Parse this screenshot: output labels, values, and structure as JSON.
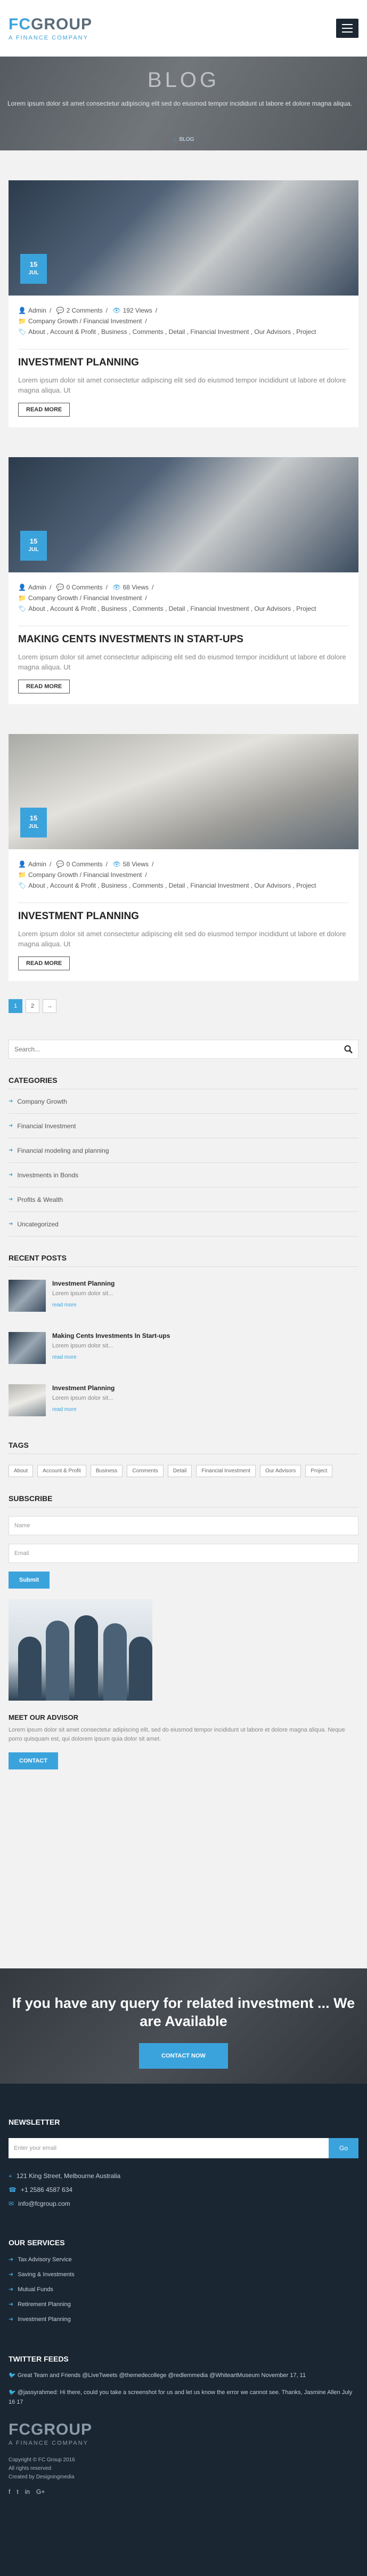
{
  "header": {
    "logo_text_a": "FC",
    "logo_text_b": "GROUP",
    "logo_tagline": "A FINANCE COMPANY"
  },
  "banner": {
    "title": "BLOG",
    "text": "Lorem ipsum dolor sit amet consectetur adipiscing elit sed do eiusmod tempor incididunt ut labore et dolore magna aliqua.",
    "crumb_home": "⌂",
    "crumb": "BLOG"
  },
  "posts": [
    {
      "day": "15",
      "month": "JUL",
      "author": "Admin",
      "comments": "2 Comments",
      "views": "192 Views",
      "cats": "Company Growth / Financial Investment",
      "tags": "About , Account & Profit , Business , Comments , Detail , Financial Investment , Our Advisors , Project",
      "title": "INVESTMENT PLANNING",
      "excerpt": "Lorem ipsum dolor sit amet consectetur adipiscing elit sed do eiusmod tempor incididunt ut labore et dolore magna aliqua. Ut",
      "read": "READ MORE"
    },
    {
      "day": "15",
      "month": "JUL",
      "author": "Admin",
      "comments": "0 Comments",
      "views": "68 Views",
      "cats": "Company Growth / Financial Investment",
      "tags": "About , Account & Profit , Business , Comments , Detail , Financial Investment , Our Advisors , Project",
      "title": "MAKING CENTS INVESTMENTS IN START-UPS",
      "excerpt": "Lorem ipsum dolor sit amet consectetur adipiscing elit sed do eiusmod tempor incididunt ut labore et dolore magna aliqua. Ut",
      "read": "READ MORE"
    },
    {
      "day": "15",
      "month": "JUL",
      "author": "Admin",
      "comments": "0 Comments",
      "views": "58 Views",
      "cats": "Company Growth / Financial Investment",
      "tags": "About , Account & Profit , Business , Comments , Detail , Financial Investment , Our Advisors , Project",
      "title": "INVESTMENT PLANNING",
      "excerpt": "Lorem ipsum dolor sit amet consectetur adipiscing elit sed do eiusmod tempor incididunt ut labore et dolore magna aliqua. Ut",
      "read": "READ MORE"
    }
  ],
  "pager": [
    "1",
    "2",
    "→"
  ],
  "search": {
    "placeholder": "Search..."
  },
  "categories": {
    "title": "CATEGORIES",
    "items": [
      "Company Growth",
      "Financial Investment",
      "Financial modeling and planning",
      "Investments in Bonds",
      "Profits & Wealth",
      "Uncategorized"
    ]
  },
  "recent": {
    "title": "RECENT POSTS",
    "items": [
      {
        "title": "Investment Planning",
        "text": "Lorem ipsum dolor sit...",
        "more": "read more"
      },
      {
        "title": "Making Cents Investments In Start-ups",
        "text": "Lorem ipsum dolor sit...",
        "more": "read more"
      },
      {
        "title": "Investment Planning",
        "text": "Lorem ipsum dolor sit...",
        "more": "read more"
      }
    ]
  },
  "tags": {
    "title": "TAGS",
    "items": [
      "About",
      "Account & Profit",
      "Business",
      "Comments",
      "Detail",
      "Financial Investment",
      "Our Advisors",
      "Project"
    ]
  },
  "subscribe": {
    "title": "SUBSCRIBE",
    "name": "Name",
    "email": "Email",
    "button": "Submit"
  },
  "advisor": {
    "title": "MEET OUR ADVISOR",
    "text": "Lorem ipsum dolor sit amet consectetur adipiscing elit, sed do eiusmod tempor incididunt ut labore et dolore magna aliqua. Neque porro quisquam est, qui dolorem ipsum quia dolor sit amet.",
    "button": "CONTACT"
  },
  "cta": {
    "title": "If you have any query for related investment ... We are Available",
    "button": "CONTACT NOW"
  },
  "footer": {
    "newsletter_title": "NEWSLETTER",
    "newsletter_placeholder": "Enter your email",
    "newsletter_button": "Go",
    "address": "121 King Street, Melbourne Australia",
    "phone": "+1 2586 4587 634",
    "email": "info@fcgroup.com",
    "services_title": "OUR SERVICES",
    "services": [
      "Tax Advisory Service",
      "Saving & Investments",
      "Mutual Funds",
      "Retirement Planning",
      "Investment Planning"
    ],
    "twitter_title": "TWITTER FEEDS",
    "tweet1": "Great Team and Friends @LiveTweets @themedecollege @redlemmedia @WhiteartMuseum November 17, 11",
    "tweet2": "@jassyrahmed: Hi there, could you take a screenshot for us and let us know the error we cannot see. Thanks, Jasmine Allen July 16 17",
    "logo_a": "FC",
    "logo_b": "GROUP",
    "logo_tagline": "A FINANCE COMPANY",
    "copy1": "Copyright © FC Group 2016",
    "copy2": "All rights reserved",
    "copy3": "Created by Designingmedia",
    "social": [
      "f",
      "t",
      "in",
      "G+"
    ]
  }
}
